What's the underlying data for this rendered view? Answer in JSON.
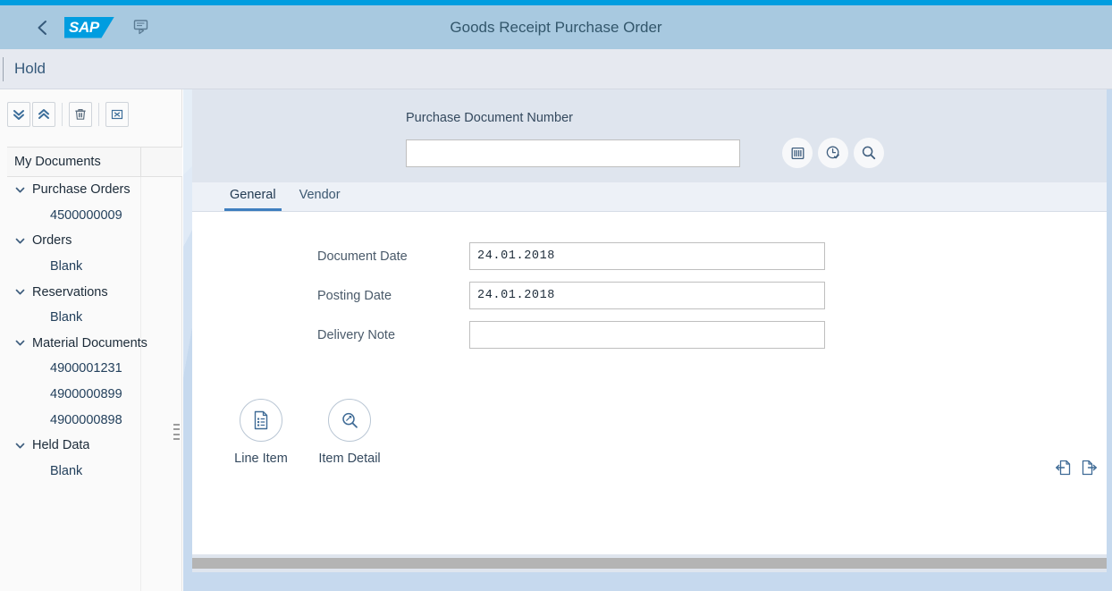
{
  "shell": {
    "back_icon": "chevron-left-icon",
    "logo_text": "SAP",
    "comment_icon": "comment-icon",
    "title": "Goods Receipt Purchase Order"
  },
  "subheader": {
    "title": "Hold"
  },
  "left_panel": {
    "toolbar": [
      {
        "name": "expand-all-button",
        "icon": "double-chevron-down-icon",
        "label": "Expand All"
      },
      {
        "name": "collapse-all-button",
        "icon": "double-chevron-up-icon",
        "label": "Collapse All"
      },
      {
        "name": "delete-button",
        "icon": "trash-icon",
        "label": "Delete"
      },
      {
        "name": "close-button",
        "icon": "close-box-icon",
        "label": "Close"
      }
    ],
    "tree_header": "My Documents",
    "tree": [
      {
        "label": "Purchase Orders",
        "type": "group",
        "expanded": true
      },
      {
        "label": "4500000009",
        "type": "item"
      },
      {
        "label": "Orders",
        "type": "group",
        "expanded": true
      },
      {
        "label": "Blank",
        "type": "item"
      },
      {
        "label": "Reservations",
        "type": "group",
        "expanded": true
      },
      {
        "label": "Blank",
        "type": "item"
      },
      {
        "label": "Material Documents",
        "type": "group",
        "expanded": true
      },
      {
        "label": "4900001231",
        "type": "item"
      },
      {
        "label": "4900000899",
        "type": "item"
      },
      {
        "label": "4900000898",
        "type": "item"
      },
      {
        "label": "Held Data",
        "type": "group",
        "expanded": true
      },
      {
        "label": "Blank",
        "type": "item"
      }
    ]
  },
  "main": {
    "search": {
      "label": "Purchase Document Number",
      "value": "",
      "placeholder": ""
    },
    "search_actions": [
      {
        "name": "barcode-scan-button",
        "icon": "barcode-icon"
      },
      {
        "name": "history-button",
        "icon": "clock-check-icon"
      },
      {
        "name": "search-button",
        "icon": "search-icon"
      }
    ],
    "tabs": [
      {
        "label": "General",
        "active": true
      },
      {
        "label": "Vendor",
        "active": false
      }
    ],
    "fields": [
      {
        "label": "Document Date",
        "value": "24.01.2018"
      },
      {
        "label": "Posting Date",
        "value": "24.01.2018"
      },
      {
        "label": "Delivery Note",
        "value": ""
      }
    ],
    "actions": [
      {
        "label": "Line Item",
        "icon": "document-list-icon"
      },
      {
        "label": "Item Detail",
        "icon": "magnifier-detail-icon"
      }
    ],
    "page_nav": [
      {
        "name": "previous-page-button",
        "icon": "page-previous-icon"
      },
      {
        "name": "next-page-button",
        "icon": "page-next-icon"
      }
    ]
  },
  "colors": {
    "accent": "#009de0",
    "shell_header": "#a8c9e0",
    "subheader": "#e6e9f0",
    "tab_active": "#3f7fbf",
    "canvas": "#c6d9ee"
  }
}
